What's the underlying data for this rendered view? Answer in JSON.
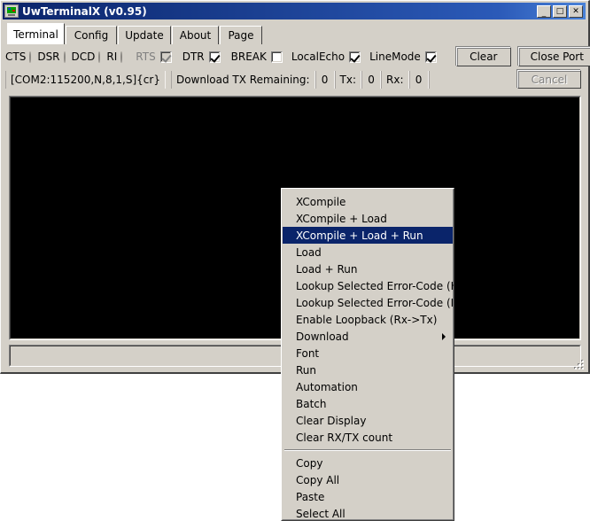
{
  "window": {
    "title": "UwTerminalX (v0.95)",
    "icon": "computer-monitor-icon",
    "buttons": {
      "minimize": "_",
      "maximize": "□",
      "close": "✕"
    }
  },
  "tabs": [
    {
      "label": "Terminal",
      "active": true
    },
    {
      "label": "Config",
      "active": false
    },
    {
      "label": "Update",
      "active": false
    },
    {
      "label": "About",
      "active": false
    },
    {
      "label": "Page",
      "active": false
    }
  ],
  "signals": [
    {
      "label": "CTS",
      "state": "green"
    },
    {
      "label": "DSR",
      "state": "red"
    },
    {
      "label": "DCD",
      "state": "red"
    },
    {
      "label": "RI",
      "state": "red"
    }
  ],
  "checkboxes": [
    {
      "label": "RTS",
      "checked": true,
      "disabled": true
    },
    {
      "label": "DTR",
      "checked": true,
      "disabled": false
    },
    {
      "label": "BREAK",
      "checked": false,
      "disabled": false
    },
    {
      "label": "LocalEcho",
      "checked": true,
      "disabled": false
    },
    {
      "label": "LineMode",
      "checked": true,
      "disabled": false
    }
  ],
  "toolbar": {
    "clear_label": "Clear",
    "close_port_label": "Close Port",
    "cancel_label": "Cancel",
    "cancel_disabled": true
  },
  "status": {
    "port_string": "[COM2:115200,N,8,1,S]{cr}",
    "download_label": "Download TX Remaining:",
    "download_value": "0",
    "tx_label": "Tx:",
    "tx_value": "0",
    "rx_label": "Rx:",
    "rx_value": "0"
  },
  "terminal": {
    "content": ""
  },
  "input_bar": {
    "value": ""
  },
  "context_menu": {
    "items": [
      {
        "label": "XCompile",
        "selected": false,
        "submenu": false
      },
      {
        "label": "XCompile + Load",
        "selected": false,
        "submenu": false
      },
      {
        "label": "XCompile + Load + Run",
        "selected": true,
        "submenu": false
      },
      {
        "label": "Load",
        "selected": false,
        "submenu": false
      },
      {
        "label": "Load + Run",
        "selected": false,
        "submenu": false
      },
      {
        "label": "Lookup Selected Error-Code (Hex)",
        "selected": false,
        "submenu": false
      },
      {
        "label": "Lookup Selected Error-Code (Int)",
        "selected": false,
        "submenu": false
      },
      {
        "label": "Enable Loopback (Rx->Tx)",
        "selected": false,
        "submenu": false
      },
      {
        "label": "Download",
        "selected": false,
        "submenu": true
      },
      {
        "label": "Font",
        "selected": false,
        "submenu": false
      },
      {
        "label": "Run",
        "selected": false,
        "submenu": false
      },
      {
        "label": "Automation",
        "selected": false,
        "submenu": false
      },
      {
        "label": "Batch",
        "selected": false,
        "submenu": false
      },
      {
        "label": "Clear Display",
        "selected": false,
        "submenu": false
      },
      {
        "label": "Clear RX/TX count",
        "selected": false,
        "submenu": false
      },
      {
        "label": "__separator__",
        "selected": false,
        "submenu": false
      },
      {
        "label": "Copy",
        "selected": false,
        "submenu": false
      },
      {
        "label": "Copy All",
        "selected": false,
        "submenu": false
      },
      {
        "label": "Paste",
        "selected": false,
        "submenu": false
      },
      {
        "label": "Select All",
        "selected": false,
        "submenu": false
      }
    ]
  },
  "colors": {
    "face": "#d4d0c8",
    "title_start": "#0a246a",
    "highlight": "#0a246a",
    "led_green": "#00b000",
    "led_red": "#d00000",
    "terminal_bg": "#000000"
  }
}
